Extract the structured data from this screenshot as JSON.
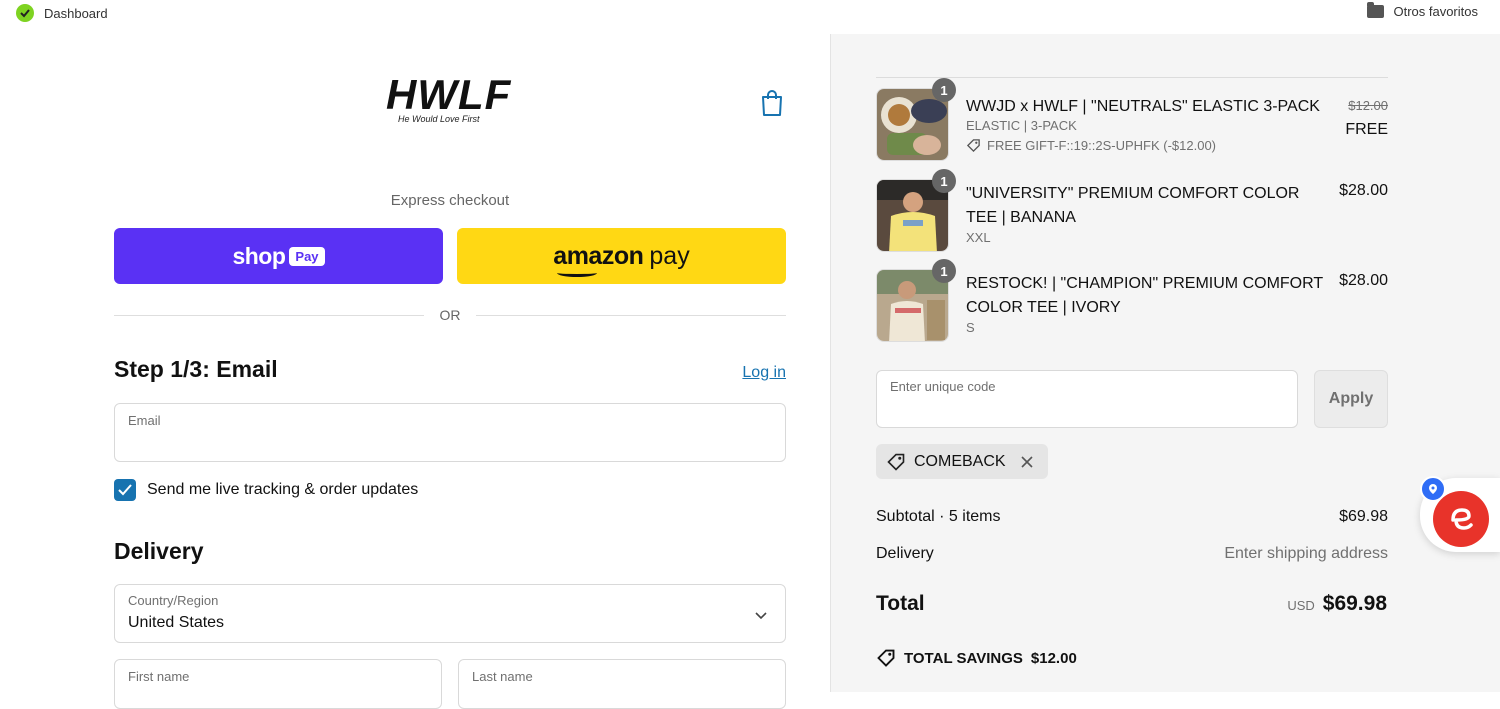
{
  "bookmarks": {
    "left_label": "Dashboard",
    "right_label": "Otros favoritos"
  },
  "brand": {
    "logo": "HWLF",
    "tagline": "He Would Love First"
  },
  "express": {
    "heading": "Express checkout",
    "shop_word": "shop",
    "shop_pay": "Pay",
    "amazon_word": "amazon",
    "amazon_pay": "pay",
    "or": "OR"
  },
  "email_step": {
    "title": "Step 1/3: Email",
    "login": "Log in",
    "email_label": "Email",
    "email_value": "",
    "tracking_label": "Send me live tracking & order updates",
    "tracking_checked": true
  },
  "delivery": {
    "title": "Delivery",
    "country_label": "Country/Region",
    "country_value": "United States",
    "first_name_label": "First name",
    "last_name_label": "Last name"
  },
  "cart": {
    "items": [
      {
        "qty": "1",
        "title": "WWJD x HWLF | \"NEUTRALS\" ELASTIC 3-PACK",
        "variant": "ELASTIC | 3-PACK",
        "original_price": "$12.00",
        "price": "FREE",
        "discount": "FREE GIFT-F::19::2S-UPHFK (-$12.00)"
      },
      {
        "qty": "1",
        "title": "\"UNIVERSITY\" PREMIUM COMFORT COLOR TEE | BANANA",
        "variant": "XXL",
        "price": "$28.00"
      },
      {
        "qty": "1",
        "title": "RESTOCK! | \"CHAMPION\" PREMIUM COMFORT COLOR TEE | IVORY",
        "variant": "S",
        "price": "$28.00"
      }
    ],
    "code_placeholder": "Enter unique code",
    "apply": "Apply",
    "applied_code": "COMEBACK",
    "subtotal_label": "Subtotal · 5 items",
    "subtotal_value": "$69.98",
    "delivery_label": "Delivery",
    "delivery_value": "Enter shipping address",
    "total_label": "Total",
    "currency": "USD",
    "total_value": "$69.98",
    "savings_label": "TOTAL SAVINGS",
    "savings_value": "$12.00"
  },
  "colors": {
    "shop_pay": "#5a31f4",
    "amazon_pay": "#ffd814",
    "link": "#1773b0",
    "widget": "#e8332a"
  }
}
